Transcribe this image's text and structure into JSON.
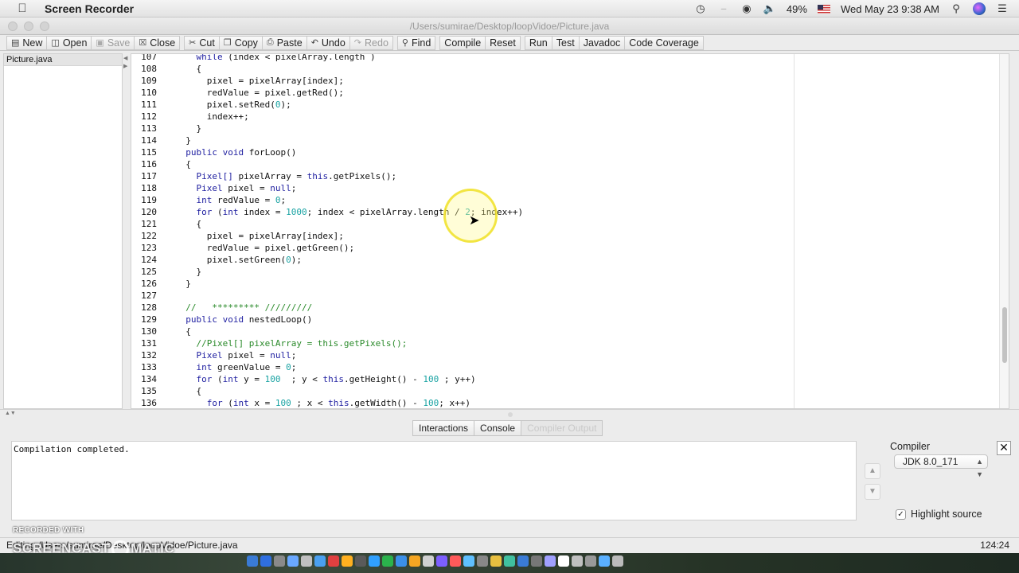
{
  "menubar": {
    "app_name": "Screen Recorder",
    "battery": "49%",
    "datetime": "Wed May 23  9:38 AM"
  },
  "window": {
    "title": "/Users/sumirae/Desktop/loopVidoe/Picture.java"
  },
  "toolbar": {
    "new": "New",
    "open": "Open",
    "save": "Save",
    "close": "Close",
    "cut": "Cut",
    "copy": "Copy",
    "paste": "Paste",
    "undo": "Undo",
    "redo": "Redo",
    "find": "Find",
    "compile": "Compile",
    "reset": "Reset",
    "run": "Run",
    "test": "Test",
    "javadoc": "Javadoc",
    "coverage": "Code Coverage"
  },
  "files": [
    "Picture.java"
  ],
  "code_lines": [
    {
      "n": "107",
      "t": "    while (index < pixelArray.length )"
    },
    {
      "n": "108",
      "t": "    {"
    },
    {
      "n": "109",
      "t": "      pixel = pixelArray[index];"
    },
    {
      "n": "110",
      "t": "      redValue = pixel.getRed();"
    },
    {
      "n": "111",
      "t": "      pixel.setRed(0);"
    },
    {
      "n": "112",
      "t": "      index++;"
    },
    {
      "n": "113",
      "t": "    }"
    },
    {
      "n": "114",
      "t": "  }"
    },
    {
      "n": "115",
      "t": "  public void forLoop()"
    },
    {
      "n": "116",
      "t": "  {"
    },
    {
      "n": "117",
      "t": "    Pixel[] pixelArray = this.getPixels();"
    },
    {
      "n": "118",
      "t": "    Pixel pixel = null;"
    },
    {
      "n": "119",
      "t": "    int redValue = 0;"
    },
    {
      "n": "120",
      "t": "    for (int index = 1000; index < pixelArray.length / 2; index++)"
    },
    {
      "n": "121",
      "t": "    {"
    },
    {
      "n": "122",
      "t": "      pixel = pixelArray[index];"
    },
    {
      "n": "123",
      "t": "      redValue = pixel.getGreen();"
    },
    {
      "n": "124",
      "t": "      pixel.setGreen(0);"
    },
    {
      "n": "125",
      "t": "    }"
    },
    {
      "n": "126",
      "t": "  }"
    },
    {
      "n": "127",
      "t": ""
    },
    {
      "n": "128",
      "t": "  //   ********* /////////"
    },
    {
      "n": "129",
      "t": "  public void nestedLoop()"
    },
    {
      "n": "130",
      "t": "  {"
    },
    {
      "n": "131",
      "t": "    //Pixel[] pixelArray = this.getPixels();"
    },
    {
      "n": "132",
      "t": "    Pixel pixel = null;"
    },
    {
      "n": "133",
      "t": "    int greenValue = 0;"
    },
    {
      "n": "134",
      "t": "    for (int y = 100  ; y < this.getHeight() - 100 ; y++)"
    },
    {
      "n": "135",
      "t": "    {"
    },
    {
      "n": "136",
      "t": "      for (int x = 100 ; x < this.getWidth() - 100; x++)"
    }
  ],
  "tabs": [
    "Interactions",
    "Console",
    "Compiler Output"
  ],
  "output_text": "Compilation completed.",
  "compiler": {
    "label": "Compiler",
    "selected": "JDK 8.0_171",
    "highlight_label": "Highlight source",
    "highlight_checked": true
  },
  "status": {
    "path": "Editing /Users/sumirae/Desktop/loopVidoe/Picture.java",
    "position": "124:24"
  },
  "watermark": {
    "line1": "RECORDED WITH",
    "brand_left": "SCREENCAST",
    "brand_right": "MATIC"
  },
  "colors": {
    "keyword": "#1e1ea0",
    "number": "#1aa3a3",
    "comment": "#2a8a2a",
    "cursor_highlight": "#f0e128"
  }
}
